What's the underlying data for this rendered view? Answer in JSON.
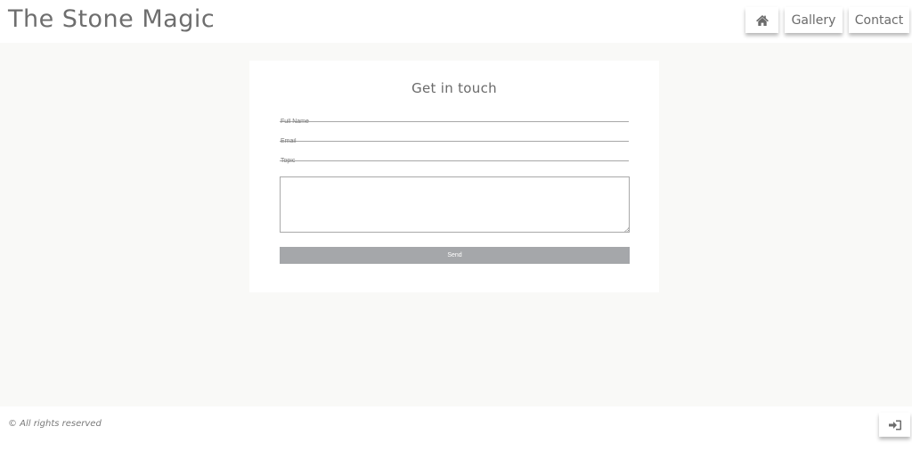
{
  "header": {
    "site_title": "The Stone Magic",
    "nav": {
      "home_icon": "home-icon",
      "gallery_label": "Gallery",
      "contact_label": "Contact"
    }
  },
  "contact_form": {
    "title": "Get in touch",
    "full_name_placeholder": "Full Name",
    "email_placeholder": "Email",
    "topic_placeholder": "Topic",
    "message_value": "",
    "send_label": "Send"
  },
  "footer": {
    "copyright": "© All rights reserved",
    "login_icon": "sign-in-icon"
  },
  "colors": {
    "page_bg": "#f9f9f7",
    "text": "#6b6b6b",
    "send_button": "#a5a7aa"
  }
}
